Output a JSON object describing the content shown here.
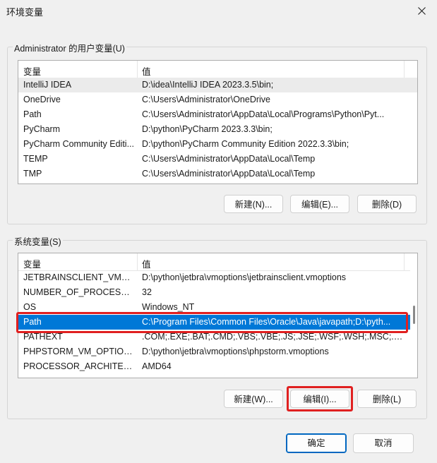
{
  "window": {
    "title": "环境变量"
  },
  "user_group": {
    "label": "Administrator 的用户变量(U)",
    "columns": [
      "变量",
      "值"
    ],
    "rows": [
      {
        "name": "IntelliJ IDEA",
        "value": "D:\\idea\\IntelliJ IDEA 2023.3.5\\bin;"
      },
      {
        "name": "OneDrive",
        "value": "C:\\Users\\Administrator\\OneDrive"
      },
      {
        "name": "Path",
        "value": "C:\\Users\\Administrator\\AppData\\Local\\Programs\\Python\\Pyt..."
      },
      {
        "name": "PyCharm",
        "value": "D:\\python\\PyCharm 2023.3.3\\bin;"
      },
      {
        "name": "PyCharm Community Editi...",
        "value": "D:\\python\\PyCharm Community Edition 2022.3.3\\bin;"
      },
      {
        "name": "TEMP",
        "value": "C:\\Users\\Administrator\\AppData\\Local\\Temp"
      },
      {
        "name": "TMP",
        "value": "C:\\Users\\Administrator\\AppData\\Local\\Temp"
      }
    ],
    "buttons": {
      "new": "新建(N)...",
      "edit": "编辑(E)...",
      "delete": "删除(D)"
    }
  },
  "system_group": {
    "label": "系统变量(S)",
    "columns": [
      "变量",
      "值"
    ],
    "rows": [
      {
        "name": "JETBRAINSCLIENT_VM_O...",
        "value": "D:\\python\\jetbra\\vmoptions\\jetbrainsclient.vmoptions"
      },
      {
        "name": "NUMBER_OF_PROCESSORS",
        "value": "32"
      },
      {
        "name": "OS",
        "value": "Windows_NT"
      },
      {
        "name": "Path",
        "value": "C:\\Program Files\\Common Files\\Oracle\\Java\\javapath;D:\\pyth..."
      },
      {
        "name": "PATHEXT",
        "value": ".COM;.EXE;.BAT;.CMD;.VBS;.VBE;.JS;.JSE;.WSF;.WSH;.MSC;.PY;.P..."
      },
      {
        "name": "PHPSTORM_VM_OPTIONS",
        "value": "D:\\python\\jetbra\\vmoptions\\phpstorm.vmoptions"
      },
      {
        "name": "PROCESSOR_ARCHITECT...",
        "value": "AMD64"
      }
    ],
    "buttons": {
      "new": "新建(W)...",
      "edit": "编辑(I)...",
      "delete": "删除(L)"
    }
  },
  "footer": {
    "ok": "确定",
    "cancel": "取消"
  },
  "colors": {
    "selection": "#0078d7",
    "highlight_box": "#e02020",
    "primary_border": "#0067c0"
  },
  "icons": {
    "close": "close-icon"
  }
}
